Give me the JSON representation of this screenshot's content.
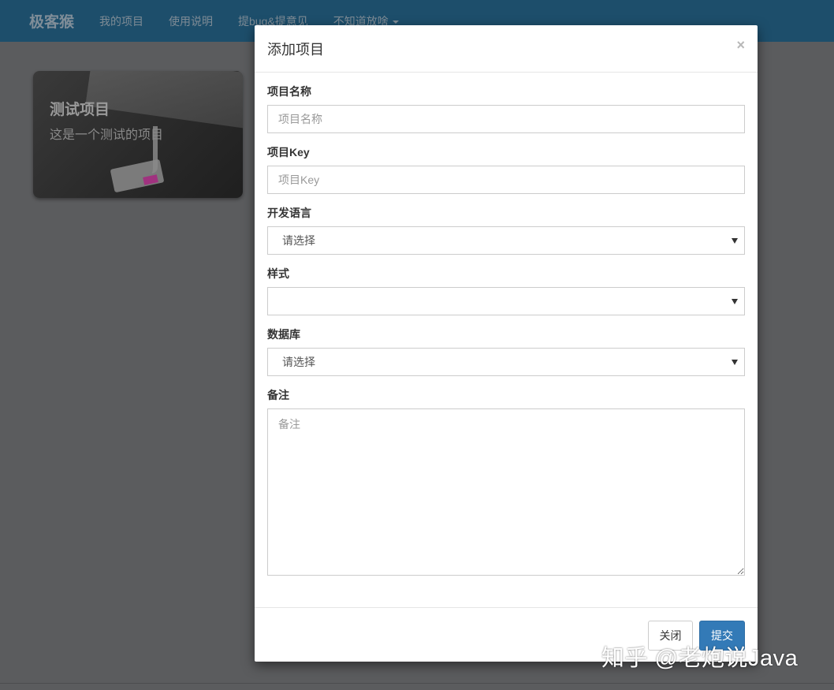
{
  "navbar": {
    "brand": "极客猴",
    "items": [
      {
        "label": "我的项目"
      },
      {
        "label": "使用说明"
      },
      {
        "label": "提bug&提意见"
      },
      {
        "label": "不知道放啥"
      }
    ]
  },
  "card": {
    "title": "测试项目",
    "description": "这是一个测试的项目"
  },
  "modal": {
    "title": "添加项目",
    "close_symbol": "×",
    "fields": {
      "name": {
        "label": "项目名称",
        "placeholder": "项目名称",
        "value": ""
      },
      "key": {
        "label": "项目Key",
        "placeholder": "项目Key",
        "value": ""
      },
      "language": {
        "label": "开发语言",
        "selected": "请选择"
      },
      "style": {
        "label": "样式",
        "selected": ""
      },
      "database": {
        "label": "数据库",
        "selected": "请选择"
      },
      "remark": {
        "label": "备注",
        "placeholder": "备注",
        "value": ""
      }
    },
    "buttons": {
      "close": "关闭",
      "submit": "提交"
    }
  },
  "watermark": "知乎 @老炮说Java",
  "colors": {
    "navbar": "#1d4e6b",
    "overlay": "#5b5c5e",
    "primary": "#337ab7"
  }
}
